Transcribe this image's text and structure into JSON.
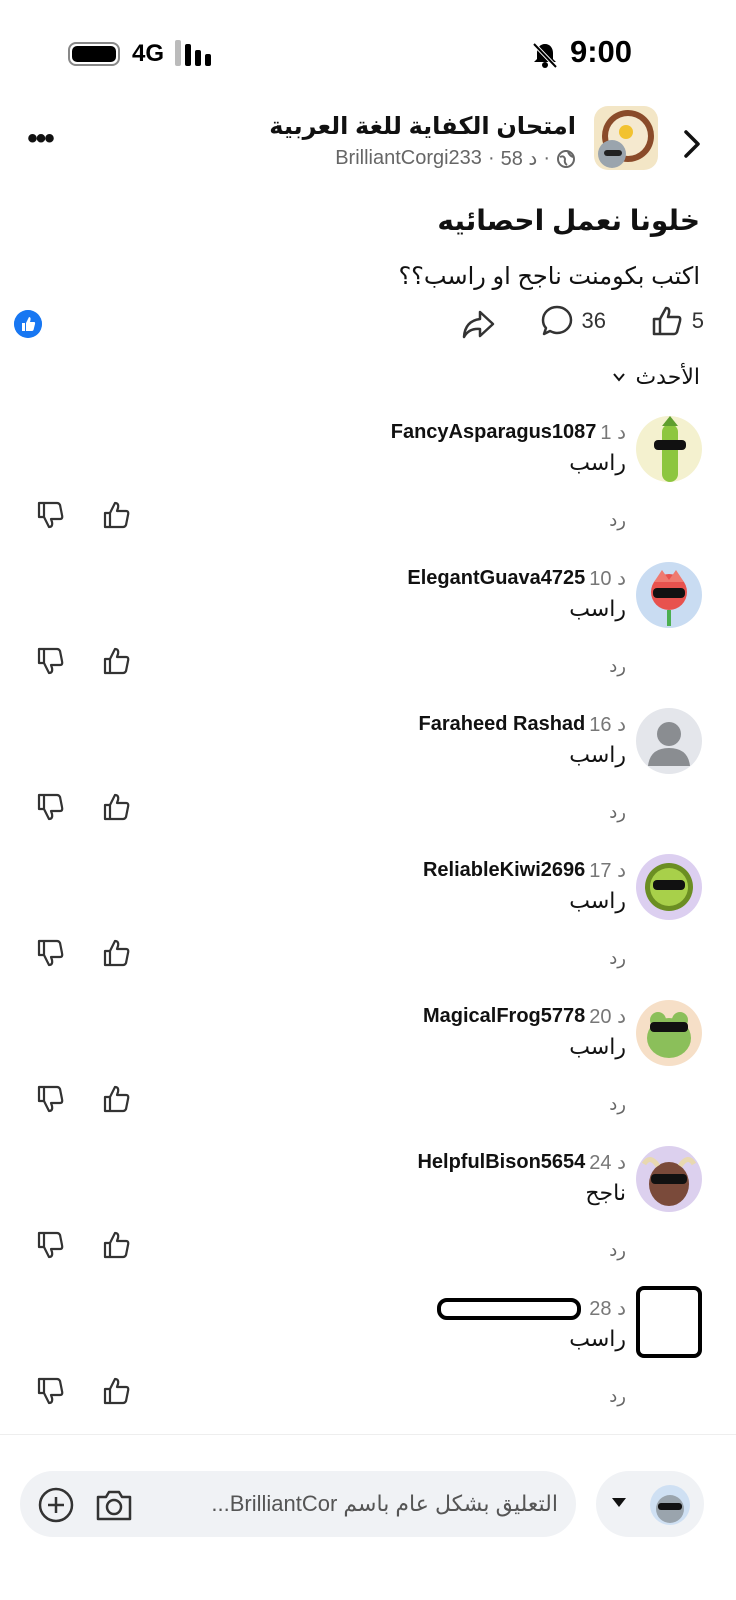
{
  "status_bar": {
    "time": "9:00",
    "network": "4G"
  },
  "header": {
    "group_name": "امتحان الكفاية للغة العربية",
    "meta_age": "58 د",
    "meta_author": "BrilliantCorgi233"
  },
  "post": {
    "title": "خلونا نعمل احصائيه",
    "body": "اكتب بكومنت ناجح او راسب؟؟",
    "upvotes": "5",
    "comments": "36"
  },
  "sort": {
    "label": "الأحدث"
  },
  "comments": [
    {
      "user": "FancyAsparagus1087",
      "time": "1 د",
      "text": "راسب",
      "reply": "رد"
    },
    {
      "user": "ElegantGuava4725",
      "time": "10 د",
      "text": "راسب",
      "reply": "رد"
    },
    {
      "user": "Faraheed Rashad",
      "time": "16 د",
      "text": "راسب",
      "reply": "رد"
    },
    {
      "user": "ReliableKiwi2696",
      "time": "17 د",
      "text": "راسب",
      "reply": "رد"
    },
    {
      "user": "MagicalFrog5778",
      "time": "20 د",
      "text": "راسب",
      "reply": "رد"
    },
    {
      "user": "HelpfulBison5654",
      "time": "24 د",
      "text": "ناجح",
      "reply": "رد"
    },
    {
      "user": "",
      "time": "28 د",
      "text": "راسب",
      "reply": "رد"
    }
  ],
  "compose": {
    "placeholder": "التعليق بشكل عام باسم BrilliantCor..."
  },
  "colors": {
    "accent": "#1877f2",
    "text": "#111111",
    "muted": "#666666",
    "input_bg": "#f0f2f5"
  }
}
